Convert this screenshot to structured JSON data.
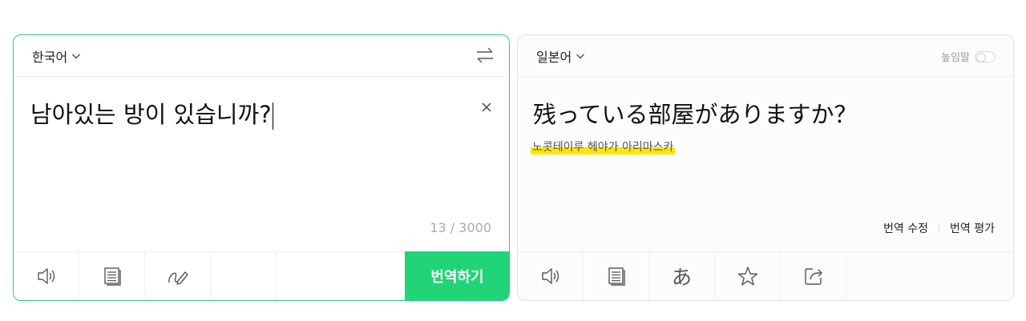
{
  "source_panel": {
    "language": "한국어",
    "text": "남아있는 방이 있습니까?",
    "counter": "13 / 3000",
    "translate_label": "번역하기"
  },
  "target_panel": {
    "language": "일본어",
    "honorific_label": "높임말",
    "honorific_on": false,
    "text": "残っている部屋がありますか？",
    "pronunciation": "노콧테이루 헤야가 아리마스카",
    "edit_label": "번역 수정",
    "rate_label": "번역 평가",
    "hiragana_glyph": "あ"
  },
  "colors": {
    "accent_green": "#21d478",
    "highlight_yellow": "#ffe500"
  },
  "icons": [
    "chevron-down-icon",
    "swap-icon",
    "close-icon",
    "speaker-icon",
    "document-icon",
    "handwriting-icon",
    "hiragana-icon",
    "star-icon",
    "share-icon"
  ]
}
